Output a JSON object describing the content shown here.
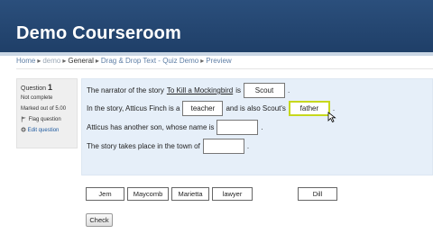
{
  "header": {
    "title": "Demo Courseroom"
  },
  "breadcrumb": [
    "Home",
    "demo",
    "General",
    "Drag & Drop Text - Quiz Demo",
    "Preview"
  ],
  "question_info": {
    "label": "Question",
    "number": "1",
    "status": "Not complete",
    "marks": "Marked out of 5.00",
    "flag_label": "Flag question",
    "edit_label": "Edit question"
  },
  "question": {
    "line1": {
      "before": "The narrator of the story",
      "title": "To Kill a Mockingbird",
      "mid": "is",
      "drop": "Scout",
      "after": "."
    },
    "line2": {
      "before": "In the story, Atticus Finch is a",
      "drop1": "teacher",
      "mid": "and is also Scout's",
      "drop2": "father",
      "after": "."
    },
    "line3": {
      "before": "Atticus has another son, whose name is",
      "drop": "",
      "after": "."
    },
    "line4": {
      "before": "The story takes place in the town of",
      "drop": "",
      "after": "."
    }
  },
  "choices": [
    "Jem",
    "Maycomb",
    "Marietta",
    "lawyer",
    "Dill"
  ],
  "check_label": "Check",
  "colors": {
    "header": "#244670",
    "panel": "#e6eff9",
    "active_drop": "#c7d81d"
  }
}
